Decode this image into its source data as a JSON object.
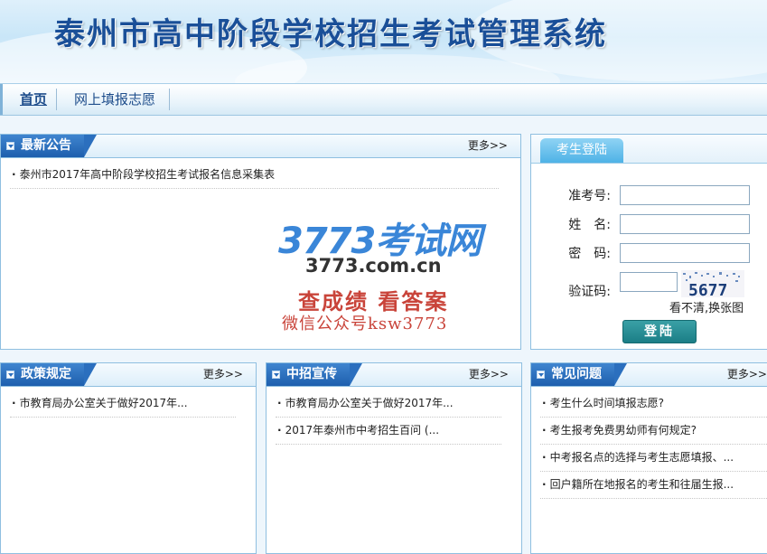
{
  "header": {
    "title": "泰州市高中阶段学校招生考试管理系统"
  },
  "nav": {
    "items": [
      "首页",
      "网上填报志愿"
    ]
  },
  "more_label": "更多>>",
  "announcements": {
    "title": "最新公告",
    "items": [
      "泰州市2017年高中阶段学校招生考试报名信息采集表"
    ]
  },
  "watermark": {
    "brand": "3773考试网",
    "site": "3773.com.cn",
    "slogan": "查成绩 看答案",
    "wechat": "微信公众号ksw3773"
  },
  "login": {
    "title": "考生登陆",
    "ticket_label": "准考号:",
    "name_label": "姓　名:",
    "password_label": "密　码:",
    "captcha_label": "验证码:",
    "ticket_value": "",
    "name_value": "",
    "password_value": "",
    "captcha_value": "",
    "captcha_text": "5677",
    "refresh_label": "看不清,换张图",
    "submit_label": "登陆"
  },
  "policy": {
    "title": "政策规定",
    "items": [
      "市教育局办公室关于做好2017年..."
    ]
  },
  "promo": {
    "title": "中招宣传",
    "items": [
      "市教育局办公室关于做好2017年...",
      "2017年泰州市中考招生百问 (..."
    ]
  },
  "faq": {
    "title": "常见问题",
    "items": [
      "考生什么时间填报志愿?",
      "考生报考免费男幼师有何规定?",
      "中考报名点的选择与考生志愿填报、...",
      "回户籍所在地报名的考生和往届生报..."
    ]
  },
  "colors": {
    "brand_blue": "#1e5fae",
    "title_blue": "#1a4f98",
    "login_tab": "#4eb2e6",
    "login_button": "#1b7e86"
  }
}
